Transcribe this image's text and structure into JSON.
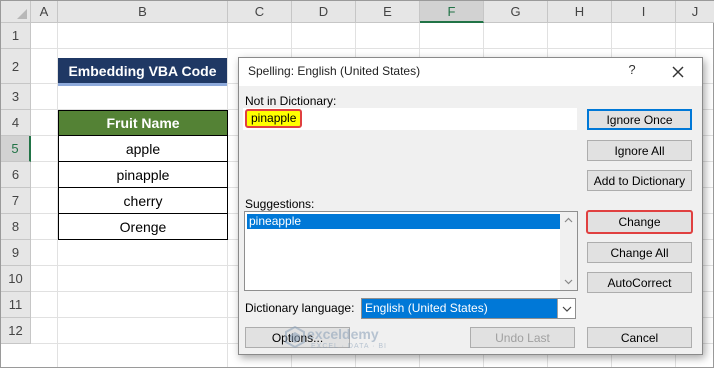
{
  "sheet": {
    "columns": [
      "A",
      "B",
      "C",
      "D",
      "E",
      "F",
      "G",
      "H",
      "I",
      "J"
    ],
    "active_column": "F",
    "rows": [
      "1",
      "2",
      "3",
      "4",
      "5",
      "6",
      "7",
      "8",
      "9",
      "10",
      "11",
      "12"
    ],
    "active_row": "5",
    "title_cell": "Embedding VBA Code",
    "table": {
      "header": "Fruit Name",
      "values": [
        "apple",
        "pinapple",
        "cherry",
        "Orenge"
      ]
    }
  },
  "dialog": {
    "title": "Spelling: English (United States)",
    "help": "?",
    "not_in_dictionary_label": "Not in Dictionary:",
    "not_in_dictionary_word": "pinapple",
    "suggestions_label": "Suggestions:",
    "suggestions": [
      "pineapple"
    ],
    "dictionary_language_label": "Dictionary language:",
    "dictionary_language": "English (United States)",
    "buttons": {
      "ignore_once": "Ignore Once",
      "ignore_all": "Ignore All",
      "add_to_dictionary": "Add to Dictionary",
      "change": "Change",
      "change_all": "Change All",
      "autocorrect": "AutoCorrect",
      "options": "Options...",
      "undo_last": "Undo Last",
      "cancel": "Cancel"
    },
    "highlight_color": "#e04040",
    "selection_color": "#0078d7"
  },
  "watermark": {
    "name": "exceldemy",
    "tagline": "EXCEL · DATA · BI"
  }
}
